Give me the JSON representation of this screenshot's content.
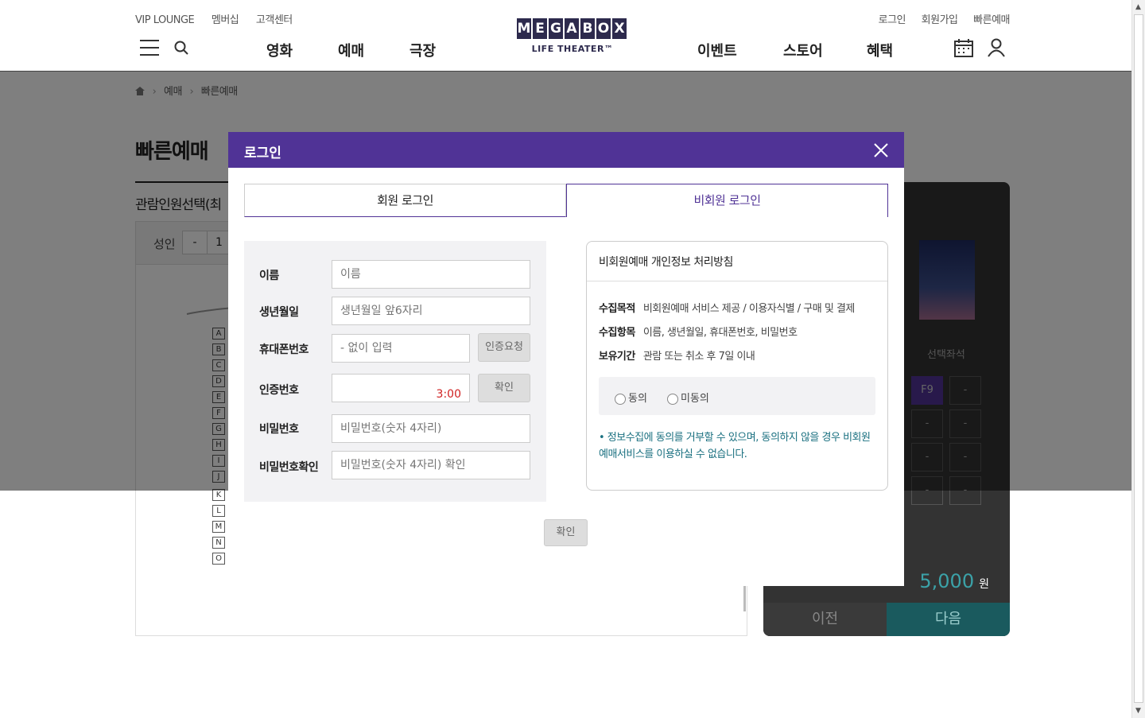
{
  "header": {
    "util_left": [
      "VIP LOUNGE",
      "멤버십",
      "고객센터"
    ],
    "util_right": [
      "로그인",
      "회원가입",
      "빠른예매"
    ],
    "logo_letters": [
      "M",
      "E",
      "G",
      "A",
      "B",
      "O",
      "X"
    ],
    "logo_sub": "LIFE THEATER™",
    "nav": [
      "영화",
      "예매",
      "극장",
      "이벤트",
      "스토어",
      "혜택"
    ]
  },
  "breadcrumb": {
    "items": [
      "예매",
      "빠른예매"
    ]
  },
  "page": {
    "title": "빠른예매",
    "subtitle": "관람인원선택(최",
    "count_label": "성인",
    "count_minus": "-",
    "count_value": "1",
    "row_labels": [
      "A",
      "B",
      "C",
      "D",
      "E",
      "F",
      "G",
      "H",
      "I",
      "J",
      "K",
      "L",
      "M",
      "N",
      "O"
    ]
  },
  "side": {
    "selected_label": "선택좌석",
    "seat_first": "F9",
    "seat_empty": "-",
    "price": "5,000",
    "price_unit": "원",
    "prev": "이전",
    "next": "다음"
  },
  "modal": {
    "title": "로그인",
    "tabs": {
      "member": "회원 로그인",
      "guest": "비회원 로그인"
    },
    "form": {
      "name_label": "이름",
      "name_placeholder": "이름",
      "birth_label": "생년월일",
      "birth_placeholder": "생년월일 앞6자리",
      "phone_label": "휴대폰번호",
      "phone_placeholder": "- 없이 입력",
      "verify_request": "인증요청",
      "code_label": "인증번호",
      "code_timer": "3:00",
      "code_confirm": "확인",
      "pw_label": "비밀번호",
      "pw_placeholder": "비밀번호(숫자 4자리)",
      "pw_confirm_label": "비밀번호확인",
      "pw_confirm_placeholder": "비밀번호(숫자 4자리) 확인"
    },
    "policy": {
      "title": "비회원예매 개인정보 처리방침",
      "rows": [
        {
          "k": "수집목적",
          "v": "비회원예매 서비스 제공 / 이용자식별 / 구매 및 결제"
        },
        {
          "k": "수집항목",
          "v": "이름, 생년월일, 휴대폰번호, 비밀번호"
        },
        {
          "k": "보유기간",
          "v": "관람 또는 취소 후 7일 이내"
        }
      ],
      "agree": "동의",
      "disagree": "미동의",
      "notice": "• 정보수집에 동의를 거부할 수 있으며, 동의하지 않을 경우 비회원 예매서비스를 이용하실 수 없습니다."
    },
    "confirm": "확인"
  },
  "colors": {
    "brand": "#503396",
    "accent": "#3ba2a8",
    "timer": "#d02020"
  }
}
